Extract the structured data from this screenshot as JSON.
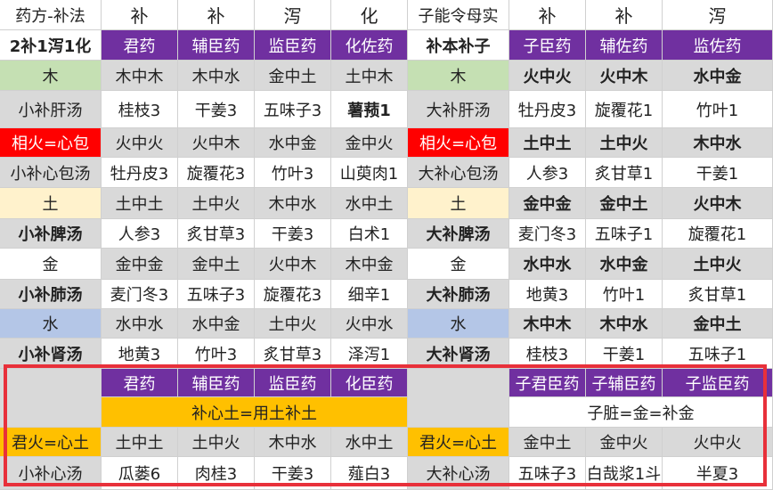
{
  "colors": {
    "purple": "#7030a0",
    "green": "#c5e0b3",
    "red": "#ff0000",
    "tan": "#fff2cc",
    "blue": "#b4c6e7",
    "gray": "#d9d9d9",
    "orange": "#ffc000",
    "white": "#ffffff",
    "text": "#222222",
    "whiteText": "#ffffff",
    "highlight": "#e8303a"
  },
  "rows": [
    {
      "bg": "white",
      "cells": [
        {
          "t": "药方-补法"
        },
        {
          "t": "补",
          "hdr": true
        },
        {
          "t": "补",
          "hdr": true
        },
        {
          "t": "泻",
          "hdr": true
        },
        {
          "t": "化",
          "hdr": true
        },
        {
          "t": "子能令母实"
        },
        {
          "t": "补",
          "hdr": true
        },
        {
          "t": "补",
          "hdr": true
        },
        {
          "t": "泻",
          "hdr": true
        }
      ]
    },
    {
      "bg": "purple",
      "cells": [
        {
          "t": "2补1泻1化",
          "b": true,
          "bg": "white"
        },
        {
          "t": "君药"
        },
        {
          "t": "辅臣药"
        },
        {
          "t": "监臣药"
        },
        {
          "t": "化佐药"
        },
        {
          "t": "补本补子",
          "b": true,
          "bg": "white"
        },
        {
          "t": "子臣药"
        },
        {
          "t": "辅佐药"
        },
        {
          "t": "监佐药"
        }
      ]
    },
    {
      "bg": "gray",
      "cells": [
        {
          "t": "木",
          "bg": "green"
        },
        {
          "t": "木中木"
        },
        {
          "t": "木中水"
        },
        {
          "t": "金中土"
        },
        {
          "t": "土中木"
        },
        {
          "t": "木",
          "bg": "green"
        },
        {
          "t": "火中火",
          "b": true
        },
        {
          "t": "火中木",
          "b": true
        },
        {
          "t": "水中金",
          "b": true
        }
      ]
    },
    {
      "bg": "white",
      "cells": [
        {
          "t": "小补肝汤",
          "bg": "gray"
        },
        {
          "t": "桂枝3"
        },
        {
          "t": "干姜3"
        },
        {
          "t": "五味子3"
        },
        {
          "t": "薯蓣1",
          "b": true
        },
        {
          "t": "大补肝汤",
          "bg": "gray"
        },
        {
          "t": "牡丹皮3"
        },
        {
          "t": "旋覆花1"
        },
        {
          "t": "竹叶1"
        }
      ]
    },
    {
      "bg": "gray",
      "cells": [
        {
          "t": "相火=心包",
          "bg": "red",
          "fg": "whiteText"
        },
        {
          "t": "火中火"
        },
        {
          "t": "火中木"
        },
        {
          "t": "水中金"
        },
        {
          "t": "金中火"
        },
        {
          "t": "相火=心包",
          "bg": "red",
          "fg": "whiteText"
        },
        {
          "t": "土中土",
          "b": true
        },
        {
          "t": "土中火",
          "b": true
        },
        {
          "t": "木中水",
          "b": true
        }
      ]
    },
    {
      "bg": "white",
      "cells": [
        {
          "t": "小补心包汤",
          "bg": "gray"
        },
        {
          "t": "牡丹皮3"
        },
        {
          "t": "旋覆花3"
        },
        {
          "t": "竹叶3"
        },
        {
          "t": "山萸肉1"
        },
        {
          "t": "大补心包汤",
          "bg": "gray"
        },
        {
          "t": "人参3"
        },
        {
          "t": "炙甘草1"
        },
        {
          "t": "干姜1"
        }
      ]
    },
    {
      "bg": "gray",
      "cells": [
        {
          "t": "土",
          "bg": "tan"
        },
        {
          "t": "土中土"
        },
        {
          "t": "土中火"
        },
        {
          "t": "木中水"
        },
        {
          "t": "水中土"
        },
        {
          "t": "土",
          "bg": "tan"
        },
        {
          "t": "金中金",
          "b": true
        },
        {
          "t": "金中土",
          "b": true
        },
        {
          "t": "火中木",
          "b": true
        }
      ]
    },
    {
      "bg": "white",
      "cells": [
        {
          "t": "小补脾汤",
          "bg": "gray",
          "b": true
        },
        {
          "t": "人参3"
        },
        {
          "t": "炙甘草3"
        },
        {
          "t": "干姜3"
        },
        {
          "t": "白术1"
        },
        {
          "t": "大补脾汤",
          "bg": "gray",
          "b": true
        },
        {
          "t": "麦门冬3"
        },
        {
          "t": "五味子1"
        },
        {
          "t": "旋覆花1"
        }
      ]
    },
    {
      "bg": "gray",
      "cells": [
        {
          "t": "金",
          "bg": "white"
        },
        {
          "t": "金中金"
        },
        {
          "t": "金中土"
        },
        {
          "t": "火中木"
        },
        {
          "t": "木中金"
        },
        {
          "t": "金",
          "bg": "white"
        },
        {
          "t": "水中水",
          "b": true
        },
        {
          "t": "水中金",
          "b": true
        },
        {
          "t": "土中火",
          "b": true
        }
      ]
    },
    {
      "bg": "white",
      "cells": [
        {
          "t": "小补肺汤",
          "bg": "gray",
          "b": true
        },
        {
          "t": "麦门冬3"
        },
        {
          "t": "五味子3"
        },
        {
          "t": "旋覆花3"
        },
        {
          "t": "细辛1"
        },
        {
          "t": "大补肺汤",
          "bg": "gray",
          "b": true
        },
        {
          "t": "地黄3"
        },
        {
          "t": "竹叶1"
        },
        {
          "t": "炙甘草1"
        }
      ]
    },
    {
      "bg": "gray",
      "cells": [
        {
          "t": "水",
          "bg": "blue"
        },
        {
          "t": "水中水"
        },
        {
          "t": "水中金"
        },
        {
          "t": "土中火"
        },
        {
          "t": "火中水"
        },
        {
          "t": "水",
          "bg": "blue"
        },
        {
          "t": "木中木",
          "b": true
        },
        {
          "t": "木中水",
          "b": true
        },
        {
          "t": "金中土",
          "b": true
        }
      ]
    },
    {
      "bg": "white",
      "cells": [
        {
          "t": "小补肾汤",
          "bg": "gray",
          "b": true
        },
        {
          "t": "地黄3"
        },
        {
          "t": "竹叶3"
        },
        {
          "t": "炙甘草3"
        },
        {
          "t": "泽泻1"
        },
        {
          "t": "大补肾汤",
          "bg": "gray",
          "b": true
        },
        {
          "t": "桂枝3"
        },
        {
          "t": "干姜1"
        },
        {
          "t": "五味子1"
        }
      ]
    },
    {
      "bg": "purple",
      "cells": [
        {
          "t": "",
          "bg": "gray",
          "rowspan": 2
        },
        {
          "t": "君药"
        },
        {
          "t": "辅臣药"
        },
        {
          "t": "监臣药"
        },
        {
          "t": "化臣药"
        },
        {
          "t": "",
          "bg": "gray",
          "rowspan": 2
        },
        {
          "t": "子君臣药"
        },
        {
          "t": "子辅臣药"
        },
        {
          "t": "子监臣药"
        }
      ]
    },
    {
      "bg": "white",
      "cells": [
        {
          "t": "补心土=用土补土",
          "bg": "orange",
          "colspan": 4
        },
        {
          "t": "子脏=金=补金",
          "bg": "white",
          "colspan": 3
        }
      ]
    },
    {
      "bg": "gray",
      "cells": [
        {
          "t": "君火=心土",
          "bg": "orange"
        },
        {
          "t": "土中土"
        },
        {
          "t": "土中火"
        },
        {
          "t": "木中水"
        },
        {
          "t": "水中土"
        },
        {
          "t": "君火=心土",
          "bg": "orange"
        },
        {
          "t": "金中土"
        },
        {
          "t": "金中火"
        },
        {
          "t": "火中火"
        }
      ]
    },
    {
      "bg": "white",
      "cells": [
        {
          "t": "小补心汤",
          "bg": "gray"
        },
        {
          "t": "瓜蒌6"
        },
        {
          "t": "肉桂3"
        },
        {
          "t": "干姜3"
        },
        {
          "t": "薤白3"
        },
        {
          "t": "大补心汤",
          "bg": "gray"
        },
        {
          "t": "五味子3"
        },
        {
          "t": "白哉浆1斗"
        },
        {
          "t": "半夏3"
        }
      ]
    }
  ]
}
